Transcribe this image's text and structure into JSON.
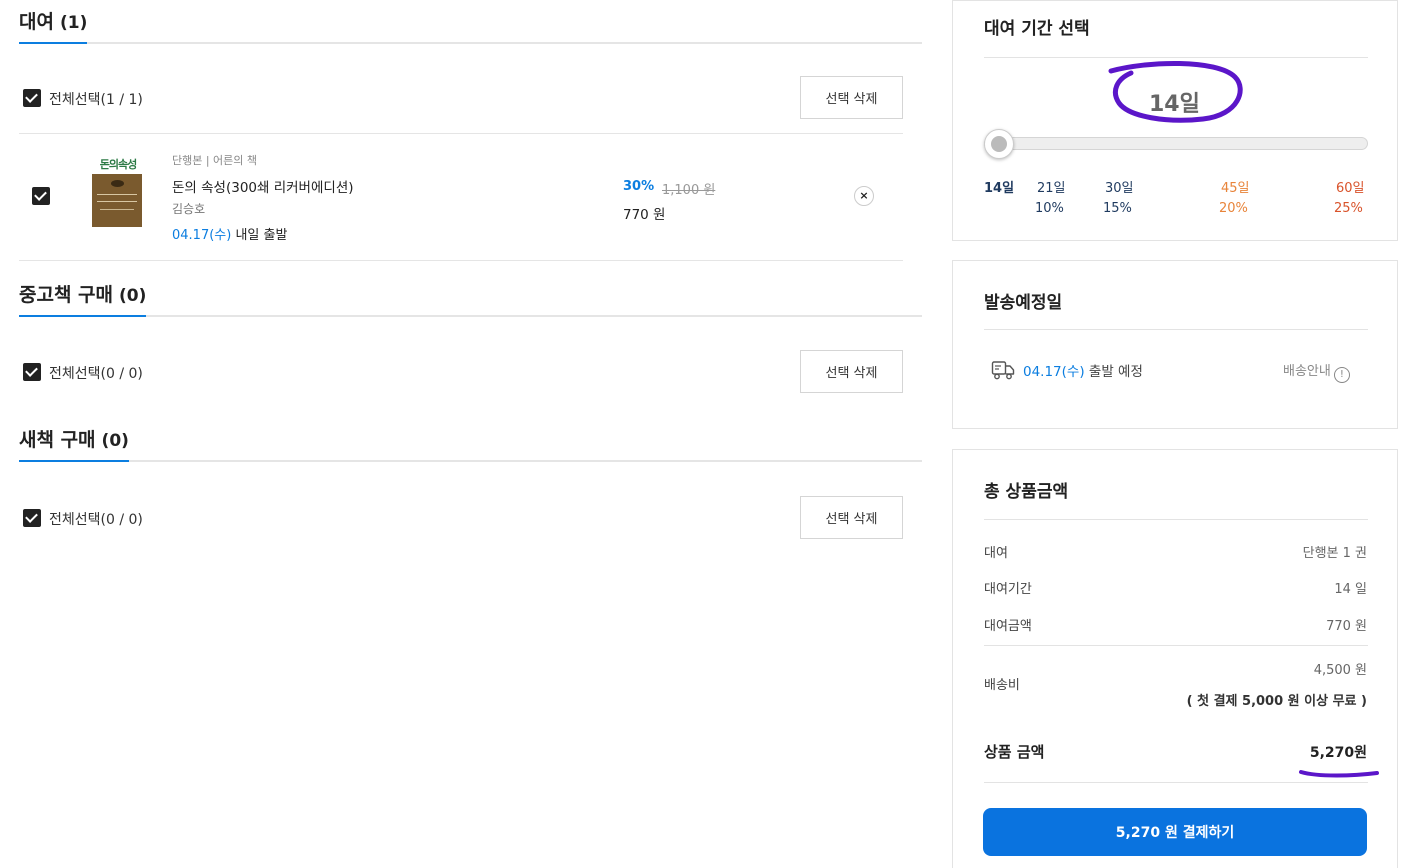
{
  "rental": {
    "title": "대여",
    "count": "(1)",
    "select_all": "전체선택(1 / 1)",
    "delete_label": "선택 삭제",
    "item": {
      "cover_title": "돈의속성",
      "meta": "단행본 | 어른의 책",
      "name": "돈의 속성(300쇄 리커버에디션)",
      "author": "김승호",
      "ship_date": "04.17(수)",
      "ship_text": " 내일 출발",
      "discount": "30%",
      "original_price": "1,100 원",
      "price": "770 원",
      "remove_icon": "×"
    }
  },
  "used": {
    "title": "중고책 구매",
    "count": "(0)",
    "select_all": "전체선택(0 / 0)",
    "delete_label": "선택 삭제"
  },
  "new_books": {
    "title": "새책 구매",
    "count": "(0)",
    "select_all": "전체선택(0 / 0)",
    "delete_label": "선택 삭제"
  },
  "period": {
    "title": "대여 기간 선택",
    "selected": "14일",
    "slider_level": 0,
    "steps": [
      {
        "days": "14일",
        "rate": ""
      },
      {
        "days": "21일",
        "rate": "10%"
      },
      {
        "days": "30일",
        "rate": "15%"
      },
      {
        "days": "45일",
        "rate": "20%"
      },
      {
        "days": "60일",
        "rate": "25%"
      }
    ],
    "colors": {
      "active": "#1f3a5f",
      "mid": "#1f3a5f",
      "orange": "#e8843a",
      "red": "#d9532b"
    }
  },
  "shipping": {
    "title": "발송예정일",
    "date": "04.17(수)",
    "text": " 출발 예정",
    "info_label": "배송안내",
    "info_icon": "!"
  },
  "total": {
    "title": "총 상품금액",
    "rows": [
      {
        "label": "대여",
        "value": "단행본 1 권"
      },
      {
        "label": "대여기간",
        "value": "14 일"
      },
      {
        "label": "대여금액",
        "value": "770 원"
      }
    ],
    "shipping_label": "배송비",
    "shipping_value": "4,500 원",
    "shipping_note": "( 첫 결제 5,000 원 이상 무료 )",
    "sum_label": "상품 금액",
    "sum_value": "5,270원",
    "pay_button": "5,270 원 결제하기"
  },
  "colors": {
    "accent": "#0a73df",
    "annotation": "#5b16c9"
  }
}
